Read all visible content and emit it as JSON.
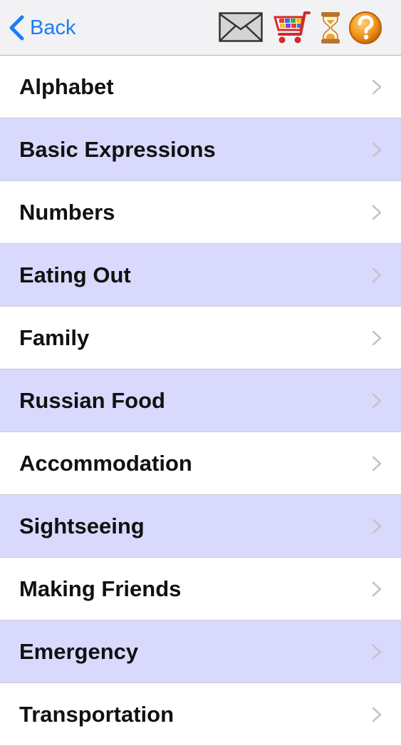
{
  "navbar": {
    "back_label": "Back",
    "accent_color": "#1a7cf3",
    "icons": [
      "mail-icon",
      "shopping-cart-icon",
      "hourglass-icon",
      "help-icon"
    ]
  },
  "rows_alt_color": "#d9d9fd",
  "list": {
    "items": [
      {
        "label": "Alphabet"
      },
      {
        "label": "Basic Expressions"
      },
      {
        "label": "Numbers"
      },
      {
        "label": "Eating Out"
      },
      {
        "label": "Family"
      },
      {
        "label": "Russian Food"
      },
      {
        "label": "Accommodation"
      },
      {
        "label": "Sightseeing"
      },
      {
        "label": "Making Friends"
      },
      {
        "label": "Emergency"
      },
      {
        "label": "Transportation"
      }
    ]
  }
}
